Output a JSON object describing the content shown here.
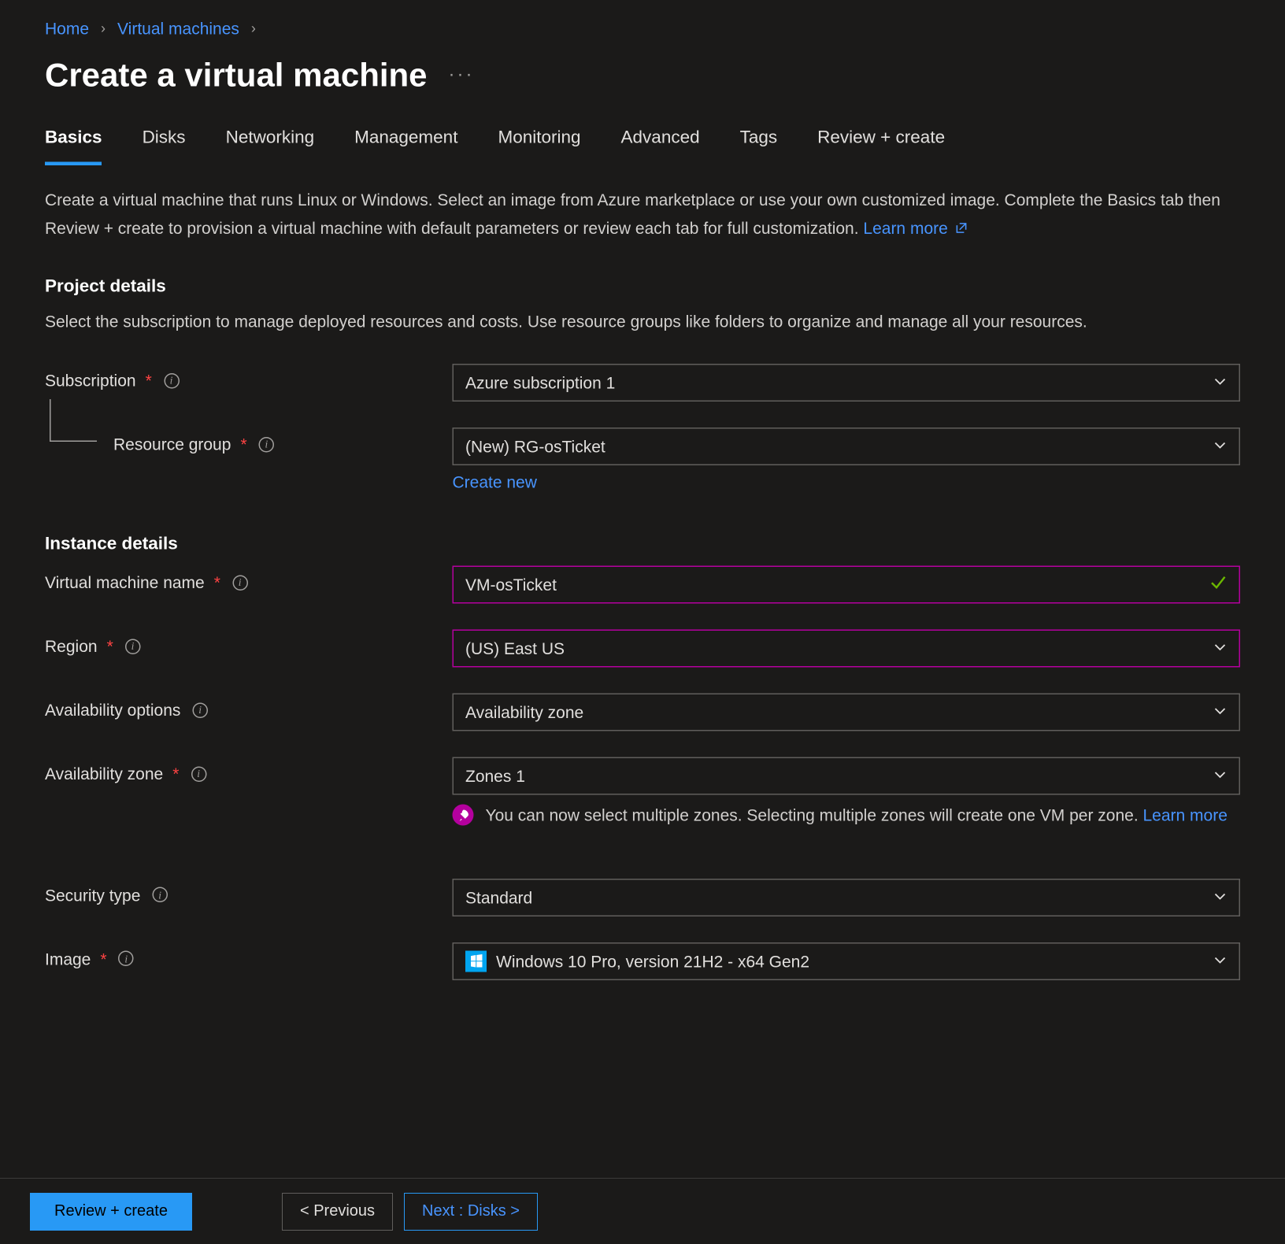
{
  "breadcrumb": {
    "home": "Home",
    "vms": "Virtual machines"
  },
  "title": "Create a virtual machine",
  "tabs": [
    {
      "label": "Basics",
      "active": true
    },
    {
      "label": "Disks"
    },
    {
      "label": "Networking"
    },
    {
      "label": "Management"
    },
    {
      "label": "Monitoring"
    },
    {
      "label": "Advanced"
    },
    {
      "label": "Tags"
    },
    {
      "label": "Review + create"
    }
  ],
  "intro": {
    "text": "Create a virtual machine that runs Linux or Windows. Select an image from Azure marketplace or use your own customized image. Complete the Basics tab then Review + create to provision a virtual machine with default parameters or review each tab for full customization. ",
    "learn_more": "Learn more"
  },
  "project": {
    "heading": "Project details",
    "sub": "Select the subscription to manage deployed resources and costs. Use resource groups like folders to organize and manage all your resources.",
    "subscription_label": "Subscription",
    "subscription_value": "Azure subscription 1",
    "rg_label": "Resource group",
    "rg_value": "(New) RG-osTicket",
    "create_new": "Create new"
  },
  "instance": {
    "heading": "Instance details",
    "vmname_label": "Virtual machine name",
    "vmname_value": "VM-osTicket",
    "region_label": "Region",
    "region_value": "(US) East US",
    "avail_opts_label": "Availability options",
    "avail_opts_value": "Availability zone",
    "avail_zone_label": "Availability zone",
    "avail_zone_value": "Zones 1",
    "zone_callout_text": "You can now select multiple zones. Selecting multiple zones will create one VM per zone. ",
    "zone_callout_link": "Learn more",
    "security_label": "Security type",
    "security_value": "Standard",
    "image_label": "Image",
    "image_value": "Windows 10 Pro, version 21H2 - x64 Gen2"
  },
  "footer": {
    "review": "Review + create",
    "previous": "< Previous",
    "next": "Next : Disks >"
  }
}
